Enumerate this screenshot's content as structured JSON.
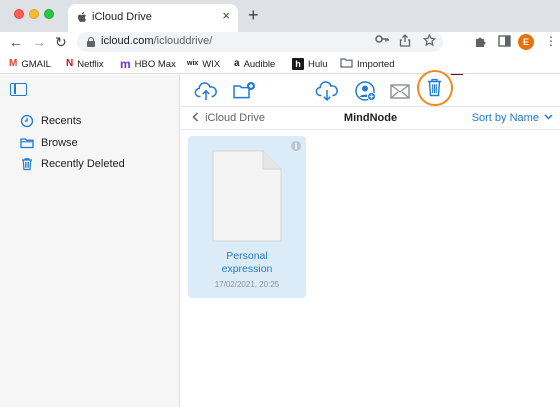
{
  "browser": {
    "tab": {
      "title": "iCloud Drive",
      "favicon": "apple-icon",
      "close": "×"
    },
    "new_tab": "+",
    "nav": {
      "back": "←",
      "forward": "→",
      "reload": "↻"
    },
    "url_domain": "icloud.com",
    "url_path": "/iclouddrive/",
    "profile_initial": "E",
    "menu": "⋮",
    "bookmarks": [
      {
        "label": "GMAIL",
        "icon": "gmail-icon",
        "glyph": "M",
        "color": "#ea4335"
      },
      {
        "label": "Netflix",
        "icon": "netflix-icon",
        "glyph": "N",
        "color": "#e50914"
      },
      {
        "label": "HBO Max",
        "icon": "hbomax-icon",
        "glyph": "m",
        "color": "#7b2bd6"
      },
      {
        "label": "WIX",
        "icon": "wix-icon",
        "glyph": "wix",
        "color": "#000000"
      },
      {
        "label": "Audible",
        "icon": "amazon-icon",
        "glyph": "a",
        "color": "#000000"
      },
      {
        "label": "Hulu",
        "icon": "hulu-icon",
        "glyph": "h",
        "color": "#ffffff"
      },
      {
        "label": "Imported",
        "icon": "folder-icon",
        "glyph": "",
        "color": "#5f6368"
      }
    ]
  },
  "icloud": {
    "sidebar": {
      "items": [
        {
          "label": "Recents",
          "icon": "clock-icon"
        },
        {
          "label": "Browse",
          "icon": "folder-icon"
        },
        {
          "label": "Recently Deleted",
          "icon": "trash-icon"
        }
      ]
    },
    "toolbar": {
      "actions": [
        "upload",
        "new-folder",
        "download",
        "share-person",
        "email",
        "delete"
      ]
    },
    "pathbar": {
      "back_label": "iCloud Drive",
      "folder_title": "MindNode",
      "sort_label": "Sort by Name"
    },
    "files": [
      {
        "name_line1": "Personal",
        "name_line2": "expression",
        "date": "17/02/2021, 20:25"
      }
    ],
    "accent_color": "#1f7bd6",
    "highlight_color": "#f08a1c"
  }
}
